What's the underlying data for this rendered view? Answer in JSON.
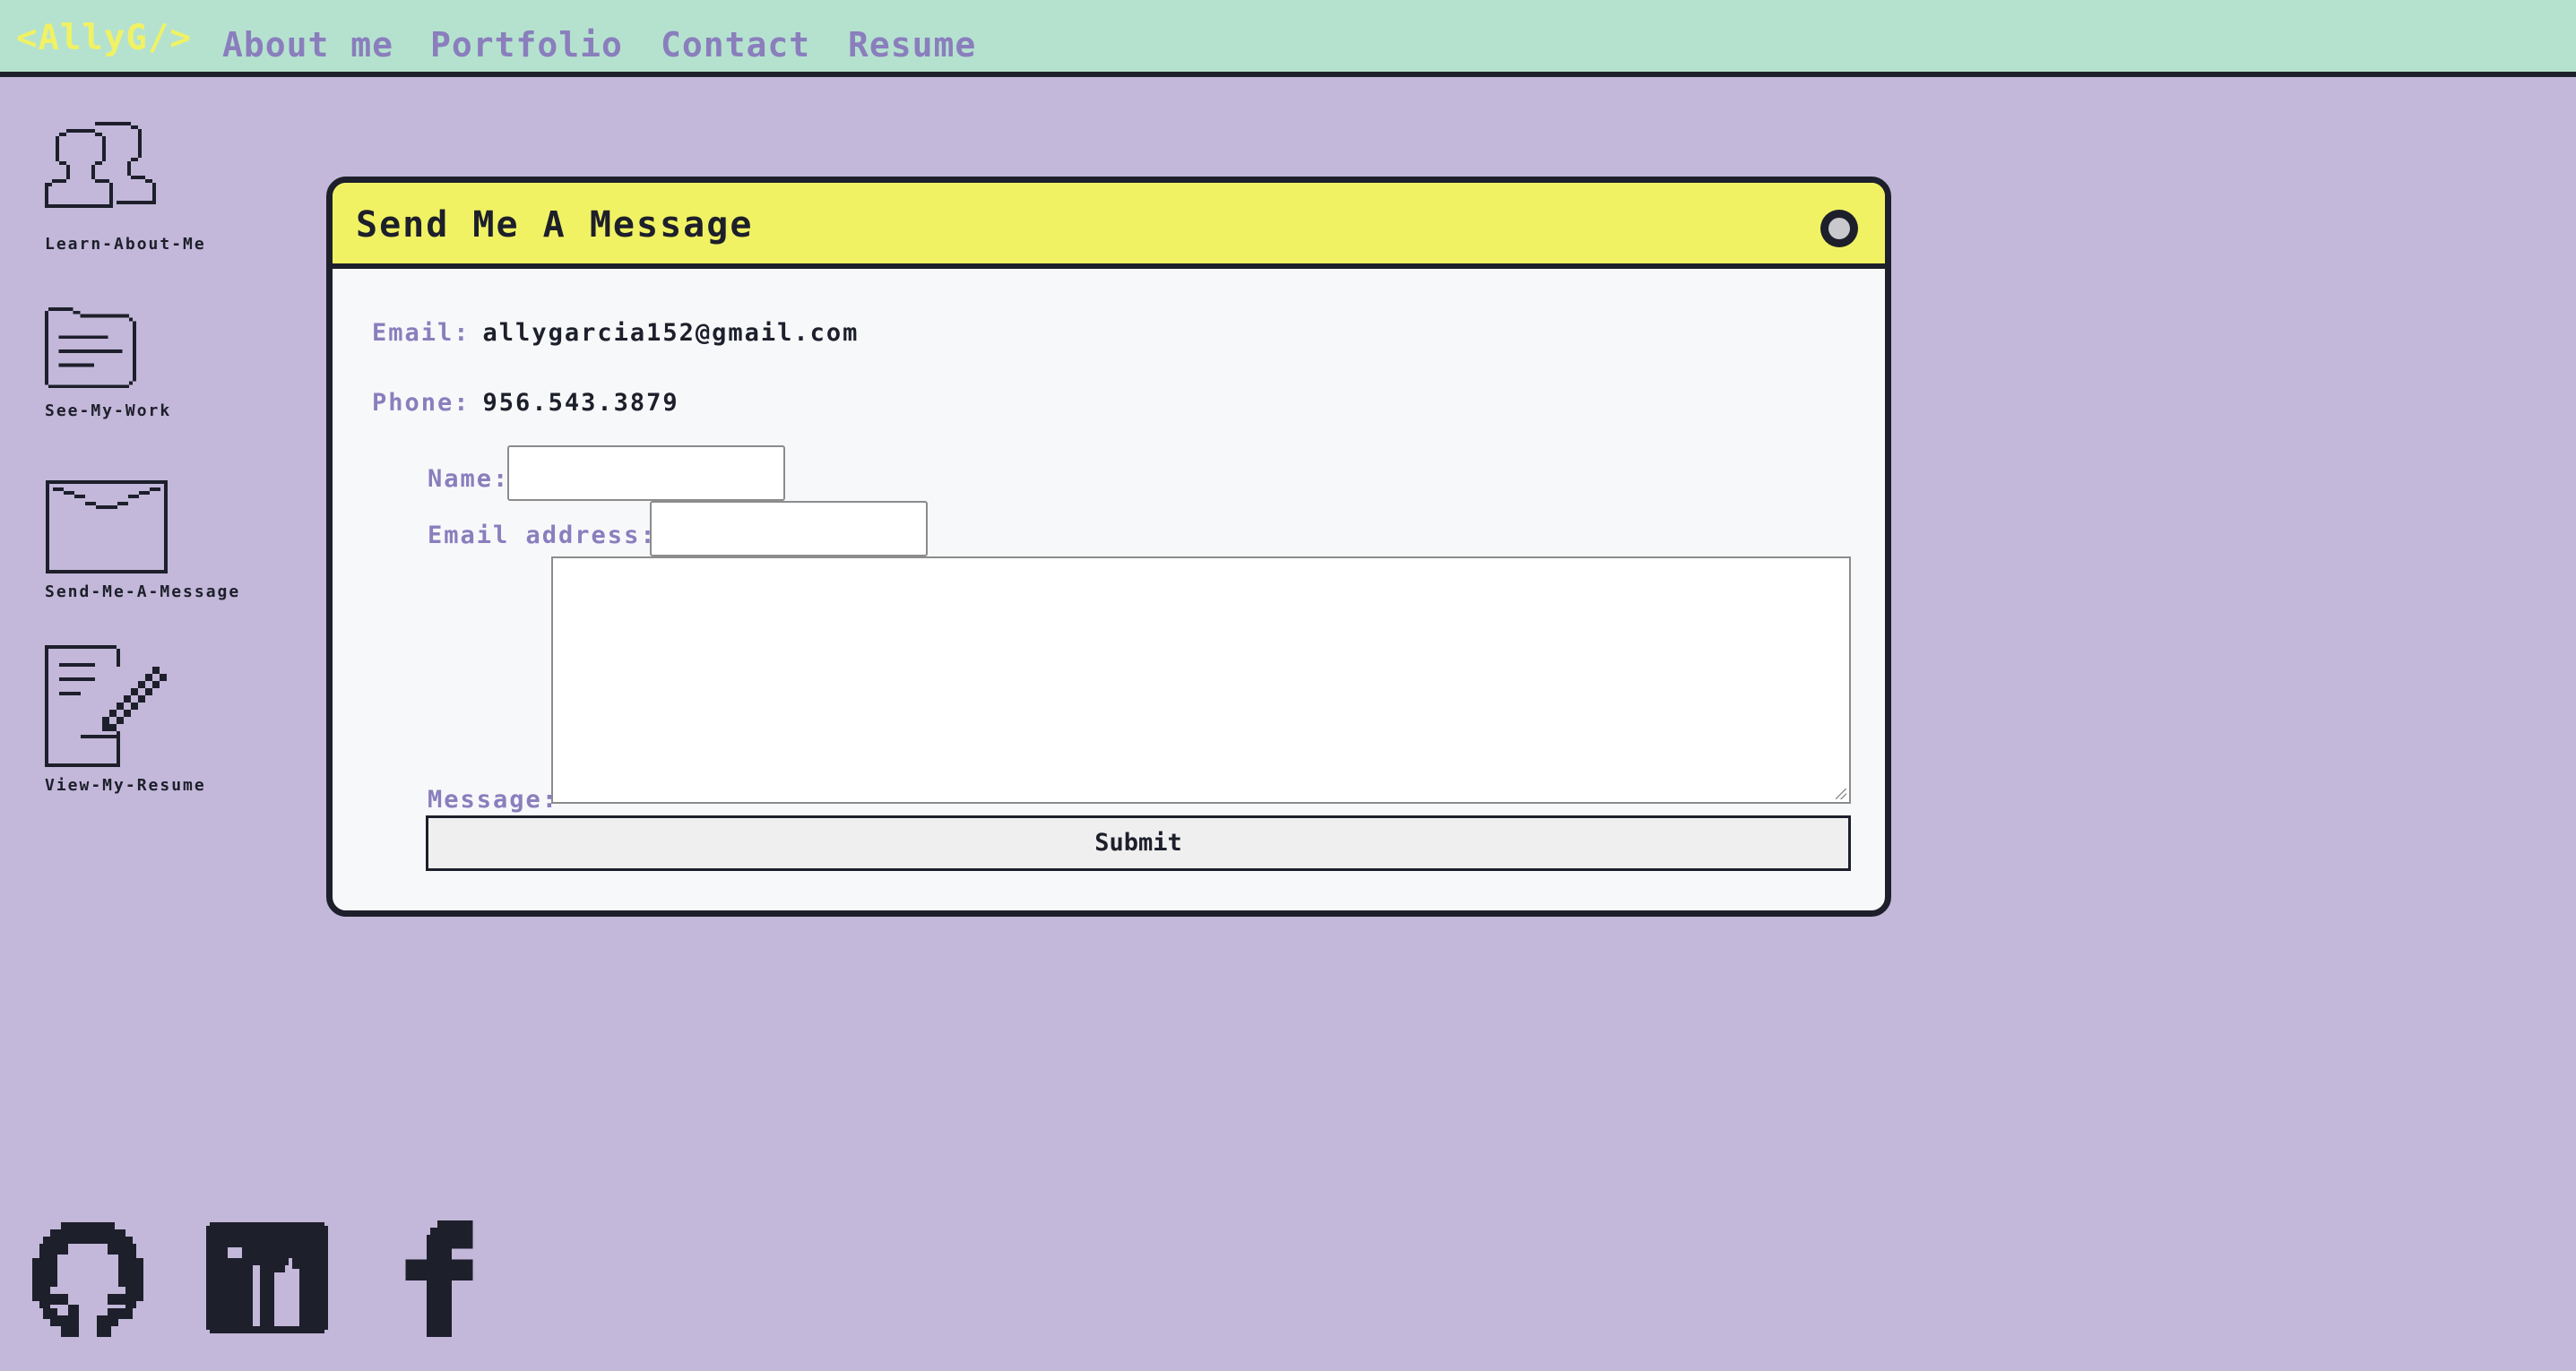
{
  "nav": {
    "brand": "<AllyG/>",
    "links": [
      "About me",
      "Portfolio",
      "Contact",
      "Resume"
    ]
  },
  "desktop_icons": [
    {
      "label": "Learn-About-Me",
      "icon": "users-icon"
    },
    {
      "label": "See-My-Work",
      "icon": "folder-icon"
    },
    {
      "label": "Send-Me-A-Message",
      "icon": "envelope-icon"
    },
    {
      "label": "View-My-Resume",
      "icon": "document-pen-icon"
    }
  ],
  "window": {
    "title": "Send Me A Message",
    "email_key": "Email:",
    "email_value": "allygarcia152@gmail.com",
    "phone_key": "Phone:",
    "phone_value": "956.543.3879",
    "form": {
      "name_label": "Name:",
      "name_value": "",
      "email_label": "Email address:",
      "email_value": "",
      "message_label": "Message:",
      "message_value": "",
      "submit_label": "Submit"
    }
  },
  "social": [
    "github-icon",
    "linkedin-icon",
    "facebook-icon"
  ],
  "colors": {
    "background": "#c3b8d9",
    "nav_bg": "#b5e2cf",
    "brand": "#f0f264",
    "nav_link": "#8a7ebd",
    "titlebar": "#f0f264",
    "ink": "#1d1f2b"
  }
}
